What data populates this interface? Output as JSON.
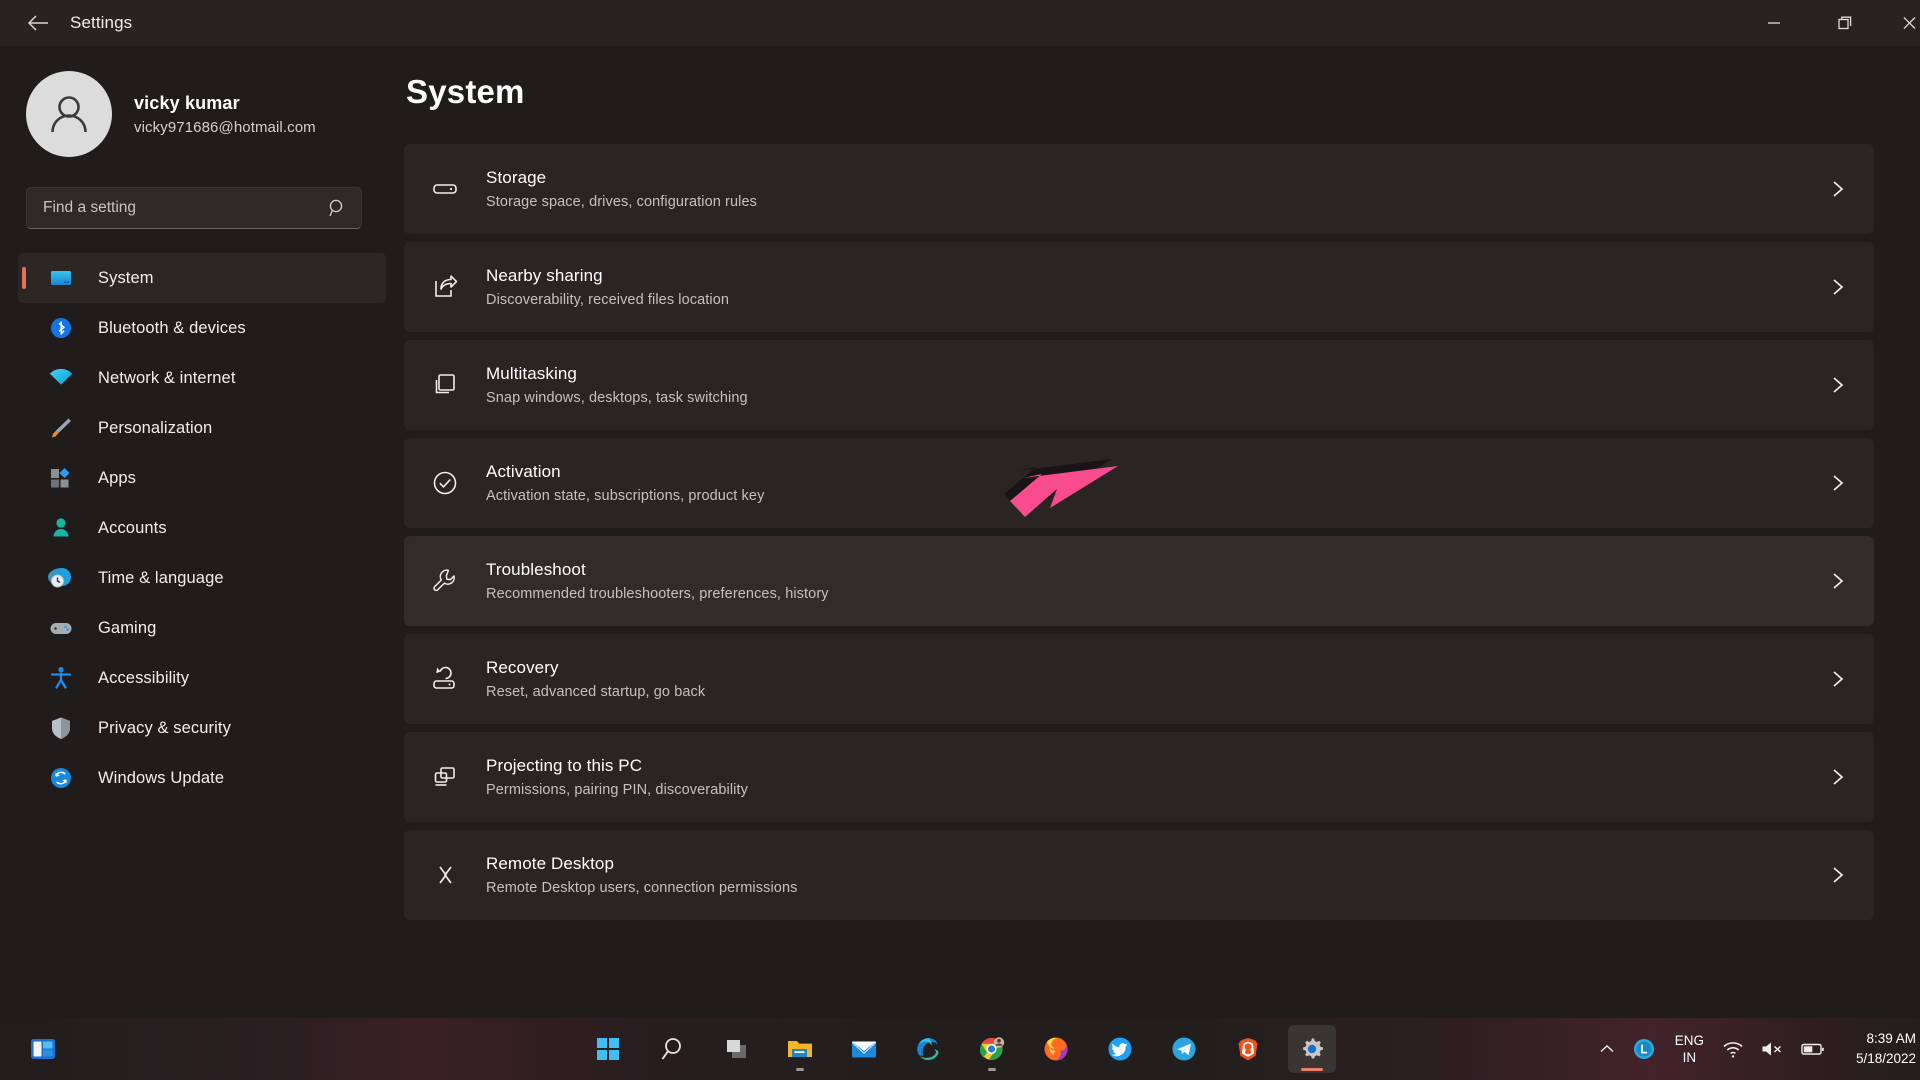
{
  "titlebar": {
    "back_label": "back-arrow",
    "title": "Settings",
    "minimize_label": "Minimize",
    "maximize_label": "Restore",
    "close_label": "Close"
  },
  "sidebar": {
    "account": {
      "name": "vicky kumar",
      "email": "vicky971686@hotmail.com"
    },
    "search": {
      "placeholder": "Find a setting",
      "value": ""
    },
    "items": [
      {
        "label": "System",
        "icon": "monitor-icon",
        "selected": true
      },
      {
        "label": "Bluetooth & devices",
        "icon": "bluetooth-icon",
        "selected": false
      },
      {
        "label": "Network & internet",
        "icon": "wifi-icon",
        "selected": false
      },
      {
        "label": "Personalization",
        "icon": "paintbrush-icon",
        "selected": false
      },
      {
        "label": "Apps",
        "icon": "apps-icon",
        "selected": false
      },
      {
        "label": "Accounts",
        "icon": "person-icon",
        "selected": false
      },
      {
        "label": "Time & language",
        "icon": "clock-globe-icon",
        "selected": false
      },
      {
        "label": "Gaming",
        "icon": "gamepad-icon",
        "selected": false
      },
      {
        "label": "Accessibility",
        "icon": "accessibility-icon",
        "selected": false
      },
      {
        "label": "Privacy & security",
        "icon": "shield-icon",
        "selected": false
      },
      {
        "label": "Windows Update",
        "icon": "update-icon",
        "selected": false
      }
    ]
  },
  "main": {
    "page_title": "System",
    "rows": [
      {
        "title": "Storage",
        "sub": "Storage space, drives, configuration rules",
        "icon": "drive-icon",
        "hovered": false
      },
      {
        "title": "Nearby sharing",
        "sub": "Discoverability, received files location",
        "icon": "share-icon",
        "hovered": false
      },
      {
        "title": "Multitasking",
        "sub": "Snap windows, desktops, task switching",
        "icon": "multitasking-icon",
        "hovered": false
      },
      {
        "title": "Activation",
        "sub": "Activation state, subscriptions, product key",
        "icon": "check-circle-icon",
        "hovered": false
      },
      {
        "title": "Troubleshoot",
        "sub": "Recommended troubleshooters, preferences, history",
        "icon": "wrench-icon",
        "hovered": true
      },
      {
        "title": "Recovery",
        "sub": "Reset, advanced startup, go back",
        "icon": "recovery-icon",
        "hovered": false
      },
      {
        "title": "Projecting to this PC",
        "sub": "Permissions, pairing PIN, discoverability",
        "icon": "project-icon",
        "hovered": false
      },
      {
        "title": "Remote Desktop",
        "sub": "Remote Desktop users, connection permissions",
        "icon": "remote-desktop-icon",
        "hovered": false
      }
    ]
  },
  "annotation": {
    "arrow_color": "#f94c8e",
    "arrow_shadow_color": "#1a1416",
    "points_at": "Troubleshoot"
  },
  "taskbar": {
    "widgets_label": "widgets-icon",
    "items": [
      {
        "name": "start-icon",
        "label": "Start"
      },
      {
        "name": "search-icon",
        "label": "Search"
      },
      {
        "name": "task-view-icon",
        "label": "Task View"
      },
      {
        "name": "file-explorer-icon",
        "label": "File Explorer"
      },
      {
        "name": "mail-icon",
        "label": "Mail"
      },
      {
        "name": "edge-icon",
        "label": "Microsoft Edge"
      },
      {
        "name": "chrome-icon",
        "label": "Google Chrome"
      },
      {
        "name": "firefox-icon",
        "label": "Firefox"
      },
      {
        "name": "twitter-icon",
        "label": "Twitter"
      },
      {
        "name": "telegram-icon",
        "label": "Telegram"
      },
      {
        "name": "brave-icon",
        "label": "Brave"
      },
      {
        "name": "settings-icon",
        "label": "Settings"
      }
    ],
    "tray": {
      "overflow": "chevron-up-icon",
      "lang_top": "ENG",
      "lang_bottom": "IN",
      "network": "wifi-icon",
      "volume": "volume-muted-icon",
      "battery": "battery-icon",
      "time": "8:39 AM",
      "date": "5/18/2022"
    },
    "accent": "#e8836b"
  }
}
